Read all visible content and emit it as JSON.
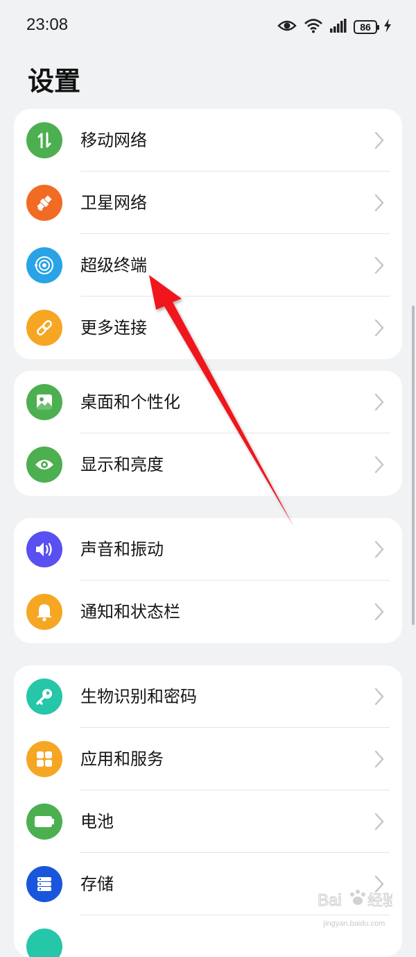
{
  "status": {
    "time": "23:08",
    "battery": "86"
  },
  "title": "设置",
  "groups": [
    {
      "items": [
        {
          "label": "移动网络",
          "icon": "mobile-network-icon",
          "color": "#4caf50"
        },
        {
          "label": "卫星网络",
          "icon": "satellite-icon",
          "color": "#f26b24"
        },
        {
          "label": "超级终端",
          "icon": "super-device-icon",
          "color": "#29a3e6"
        },
        {
          "label": "更多连接",
          "icon": "link-icon",
          "color": "#f5a623"
        }
      ]
    },
    {
      "items": [
        {
          "label": "桌面和个性化",
          "icon": "wallpaper-icon",
          "color": "#4caf50"
        },
        {
          "label": "显示和亮度",
          "icon": "eye-icon",
          "color": "#4caf50"
        }
      ]
    },
    {
      "items": [
        {
          "label": "声音和振动",
          "icon": "speaker-icon",
          "color": "#5a4ff0"
        },
        {
          "label": "通知和状态栏",
          "icon": "bell-icon",
          "color": "#f5a623"
        }
      ]
    },
    {
      "items": [
        {
          "label": "生物识别和密码",
          "icon": "key-icon",
          "color": "#26c6a8"
        },
        {
          "label": "应用和服务",
          "icon": "apps-icon",
          "color": "#f5a623"
        },
        {
          "label": "电池",
          "icon": "battery-icon",
          "color": "#4caf50"
        },
        {
          "label": "存储",
          "icon": "storage-icon",
          "color": "#1a56db"
        }
      ]
    }
  ],
  "watermark": {
    "text": "jingyan.baidu.com"
  }
}
